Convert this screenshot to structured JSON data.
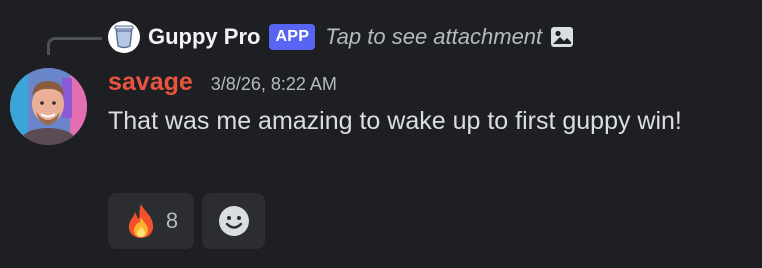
{
  "reply": {
    "author": "Guppy Pro",
    "badge": "APP",
    "text": "Tap to see attachment",
    "icon": "image-icon"
  },
  "message": {
    "username": "savage",
    "username_color": "#e8543f",
    "timestamp": "3/8/26, 8:22 AM",
    "text": "That was me amazing to wake up to first guppy win!"
  },
  "reactions": [
    {
      "emoji": "fire-emoji",
      "count": "8"
    },
    {
      "emoji": "add-reaction-smiley-icon"
    }
  ],
  "colors": {
    "background": "#1e1f22",
    "accent": "#5865f2",
    "reaction_bg": "#2b2d31"
  }
}
